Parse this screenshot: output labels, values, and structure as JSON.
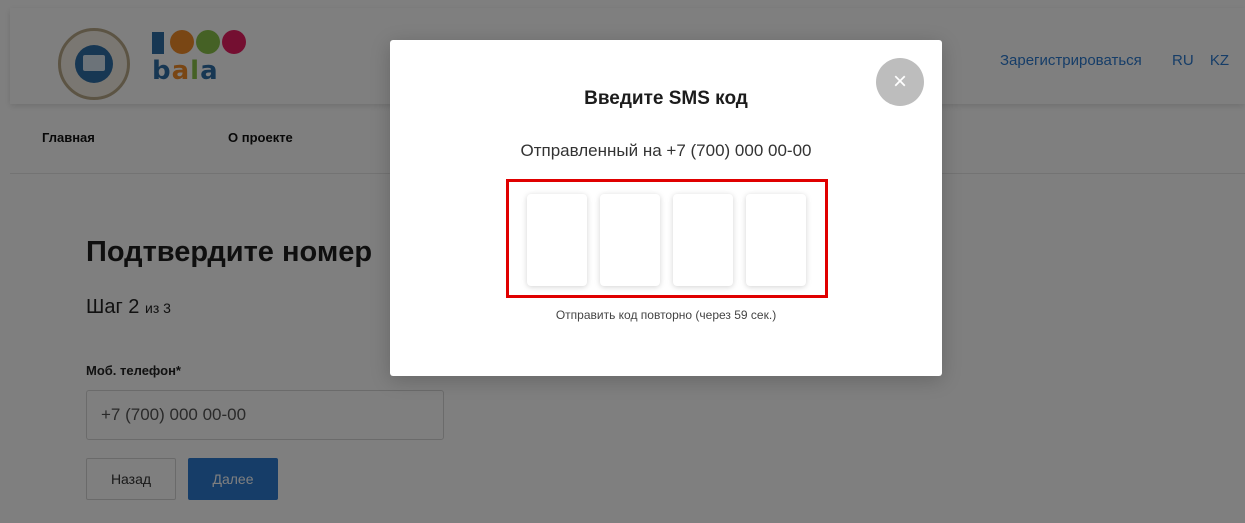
{
  "header": {
    "logo_seal_text": "ELBASY ACADEMY",
    "logo_brand": {
      "number": "1000",
      "word": "bala"
    },
    "links": [
      {
        "label": "Зарегистрироваться"
      },
      {
        "label": "RU"
      },
      {
        "label": "KZ"
      }
    ]
  },
  "nav": {
    "items": [
      {
        "label": "Главная"
      },
      {
        "label": "О проекте"
      }
    ]
  },
  "form": {
    "title": "Подтвердите номер",
    "step_prefix": "Шаг 2",
    "step_suffix": "из 3",
    "phone_label": "Моб. телефон*",
    "phone_value": "+7 (700) 000 00-00",
    "back_label": "Назад",
    "next_label": "Далее"
  },
  "modal": {
    "title": "Введите SMS код",
    "subtitle": "Отправленный на +7 (700) 000 00-00",
    "close_symbol": "×",
    "code_boxes": [
      "",
      "",
      "",
      ""
    ],
    "resend_text": "Отправить код повторно (через 59 сек.)"
  },
  "colors": {
    "accent": "#2c7bd1",
    "highlight": "#e00000",
    "overlay": "rgba(0,0,0,0.5)"
  }
}
